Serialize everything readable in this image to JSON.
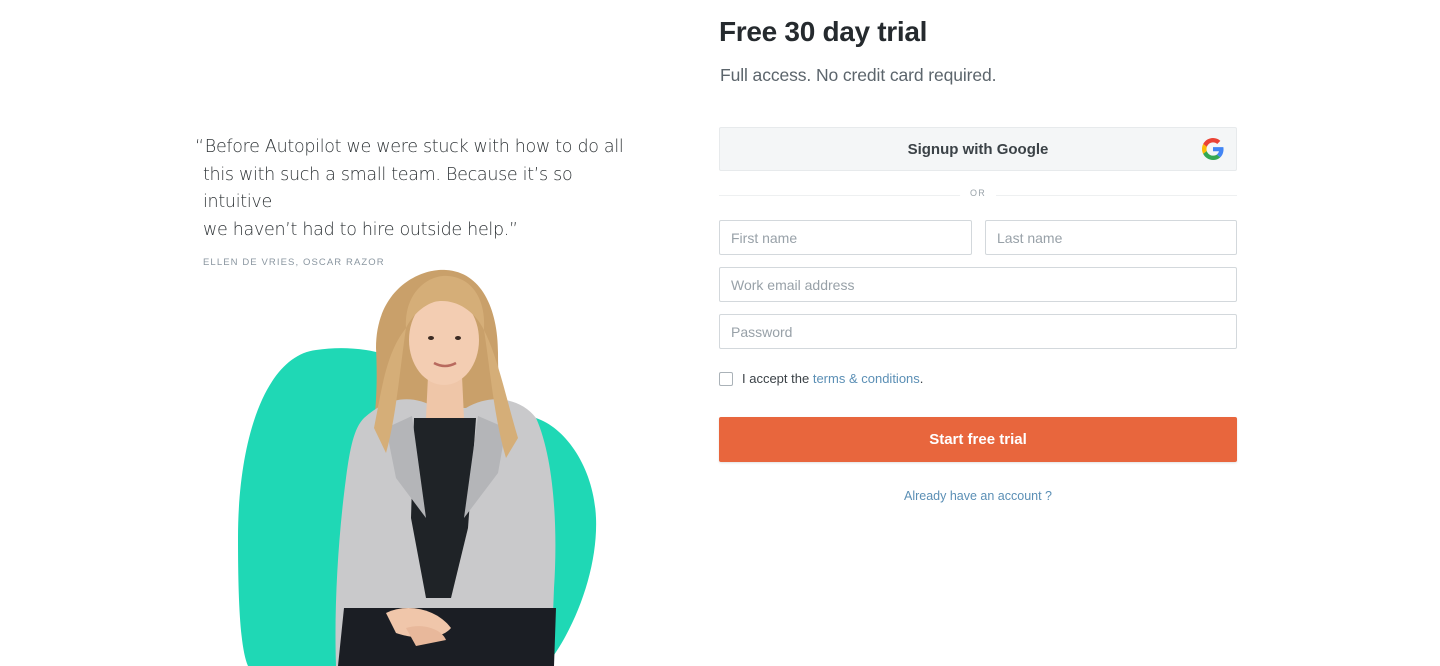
{
  "testimonial": {
    "quote_lines": [
      "Before Autopilot we were stuck with how to do all",
      "this with such a small team. Because it’s so intuitive",
      "we haven’t had to hire outside help.”"
    ],
    "open_quote": "“",
    "attribution": "ELLEN DE VRIES, OSCAR RAZOR"
  },
  "signup": {
    "title": "Free 30 day trial",
    "subtitle": "Full access. No credit card required.",
    "google_button_label": "Signup with Google",
    "divider_text": "OR",
    "first_name_placeholder": "First name",
    "last_name_placeholder": "Last name",
    "email_placeholder": "Work email address",
    "password_placeholder": "Password",
    "terms_prefix": "I accept the ",
    "terms_link": "terms & conditions",
    "terms_suffix": ".",
    "cta_label": "Start free trial",
    "login_link": "Already have an account ?"
  },
  "icons": {
    "google": "google-g-icon",
    "checkbox": "checkbox-icon"
  },
  "colors": {
    "accent": "#e8663d",
    "link": "#5b8fb5",
    "blob": "#1fd8b5"
  }
}
